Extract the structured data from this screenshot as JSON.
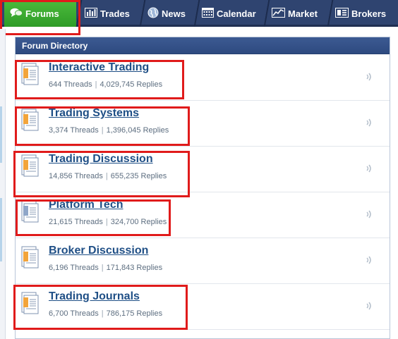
{
  "nav": {
    "tabs": [
      {
        "label": "Forums",
        "icon": "chat-bubbles-icon",
        "active": true
      },
      {
        "label": "Trades",
        "icon": "bar-chart-icon",
        "active": false
      },
      {
        "label": "News",
        "icon": "globe-icon",
        "active": false
      },
      {
        "label": "Calendar",
        "icon": "calendar-icon",
        "active": false
      },
      {
        "label": "Market",
        "icon": "market-chart-icon",
        "active": false
      },
      {
        "label": "Brokers",
        "icon": "brokers-icon",
        "active": false
      }
    ],
    "colors": {
      "bar": "#2f4470",
      "active": "#3fae34",
      "highlight": "#e01b1b"
    }
  },
  "panel": {
    "title": "Forum Directory",
    "separator": "|",
    "forums": [
      {
        "title": "Interactive Trading",
        "threads": "644 Threads",
        "replies": "4,029,745 Replies",
        "icon": "forum-doc-icon",
        "highlighted": true
      },
      {
        "title": "Trading Systems",
        "threads": "3,374 Threads",
        "replies": "1,396,045 Replies",
        "icon": "forum-doc-icon",
        "highlighted": true
      },
      {
        "title": "Trading Discussion",
        "threads": "14,856 Threads",
        "replies": "655,235 Replies",
        "icon": "forum-doc-icon",
        "highlighted": true
      },
      {
        "title": "Platform Tech",
        "threads": "21,615 Threads",
        "replies": "324,700 Replies",
        "icon": "forum-doc-blue-icon",
        "highlighted": true
      },
      {
        "title": "Broker Discussion",
        "threads": "6,196 Threads",
        "replies": "171,843 Replies",
        "icon": "forum-doc-icon",
        "highlighted": false
      },
      {
        "title": "Trading Journals",
        "threads": "6,700 Threads",
        "replies": "786,175 Replies",
        "icon": "forum-doc-icon",
        "highlighted": true
      }
    ]
  }
}
